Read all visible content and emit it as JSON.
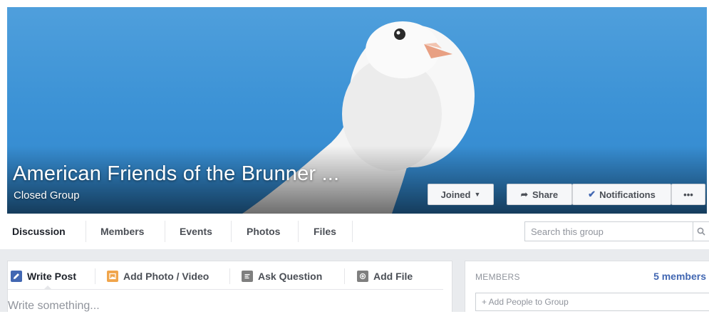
{
  "cover": {
    "title": "American Friends of the Brunner ...",
    "privacy": "Closed Group",
    "buttons": {
      "joined": "Joined",
      "share": "Share",
      "notifications": "Notifications",
      "more": "•••"
    },
    "icons": [
      "caret-down-icon",
      "share-arrow-icon",
      "checkmark-icon",
      "more-dots-icon"
    ]
  },
  "nav": {
    "tabs": [
      "Discussion",
      "Members",
      "Events",
      "Photos",
      "Files"
    ],
    "active": "Discussion",
    "search_placeholder": "Search this group"
  },
  "composer": {
    "tabs": [
      "Write Post",
      "Add Photo / Video",
      "Ask Question",
      "Add File"
    ],
    "placeholder": "Write something..."
  },
  "members_panel": {
    "heading": "MEMBERS",
    "count": "5 members",
    "add_people": "+ Add People to Group"
  },
  "colors": {
    "cover_sky": "#3d93d6",
    "facebook_blue": "#4267b2",
    "text_dark": "#4b4f56",
    "page_bg": "#e9ebee"
  }
}
